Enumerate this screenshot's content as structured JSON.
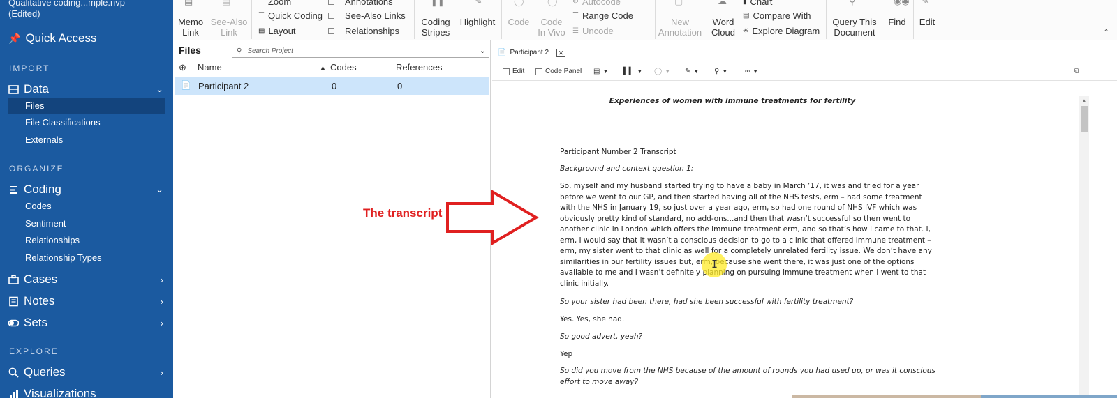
{
  "sidebar": {
    "project_title_line1": "Qualitative coding...mple.nvp",
    "project_title_line2": "(Edited)",
    "quick_access": "Quick Access",
    "sections": {
      "import": "IMPORT",
      "organize": "ORGANIZE",
      "explore": "EXPLORE"
    },
    "data": {
      "label": "Data",
      "items": [
        "Files",
        "File Classifications",
        "Externals"
      ]
    },
    "coding": {
      "label": "Coding",
      "items": [
        "Codes",
        "Sentiment",
        "Relationships",
        "Relationship Types"
      ]
    },
    "cases": "Cases",
    "notes": "Notes",
    "sets": "Sets",
    "queries": "Queries",
    "visualizations": "Visualizations"
  },
  "ribbon": {
    "memo_link": [
      "Memo",
      "Link"
    ],
    "see_also_link": [
      "See-Also",
      "Link"
    ],
    "zoom": "Zoom",
    "quick_coding": "Quick Coding",
    "layout": "Layout",
    "annotations": "Annotations",
    "see_also_links": "See-Also Links",
    "relationships": "Relationships",
    "coding_stripes": [
      "Coding",
      "Stripes"
    ],
    "highlight": "Highlight",
    "code": "Code",
    "code_in_vivo": [
      "Code",
      "In Vivo"
    ],
    "autocode": "Autocode",
    "range_code": "Range Code",
    "uncode": "Uncode",
    "new_annotation": [
      "New",
      "Annotation"
    ],
    "word_cloud": [
      "Word",
      "Cloud"
    ],
    "chart": "Chart",
    "compare_with": "Compare With",
    "explore_diagram": "Explore Diagram",
    "query_this_document": [
      "Query This",
      "Document"
    ],
    "find": "Find",
    "edit": "Edit"
  },
  "files_panel": {
    "title": "Files",
    "search_placeholder": "Search Project",
    "columns": {
      "name": "Name",
      "codes": "Codes",
      "references": "References"
    },
    "rows": [
      {
        "name": "Participant 2",
        "codes": "0",
        "references": "0"
      }
    ]
  },
  "document": {
    "tab_label": "Participant 2",
    "toolbar": {
      "edit": "Edit",
      "code_panel": "Code Panel"
    },
    "title": "Experiences of women with immune treatments for fertility",
    "heading": "Participant Number 2 Transcript",
    "question1": "Background and context question 1:",
    "answer1": [
      "So, myself and my husband started trying to have a baby in March ’17, it was and tried for a year",
      "before we went to our GP, and then started having all of the NHS tests, erm – had some treatment",
      "with the NHS in January 19, so just over a year ago, erm, so had one round of NHS IVF which was",
      "obviously pretty kind of standard, no add-ons...and then that wasn’t successful so then went to",
      "another clinic  in London which offers the immune treatment erm, and so that’s how I came to that. I,",
      "erm, I would say that it wasn’t a conscious decision to go to a clinic that offered immune treatment –",
      "erm, my sister went to that clinic as well for a completely unrelated fertility issue. We don’t have any",
      "similarities in our fertility issues but, erm, because she went there, it was just one of the options",
      "available to me and I wasn’t definitely planning on pursuing immune treatment when I went to that",
      "clinic initially."
    ],
    "q2": "So your sister had been there, had she been successful with fertility treatment?",
    "a2": "Yes. Yes, she had.",
    "q3": "So good advert, yeah?",
    "a3": "Yep",
    "q4": [
      "So did you move from the NHS because of the amount of rounds you had used up, or was it conscious",
      "effort to move away?"
    ]
  },
  "annotation": {
    "label": "The transcript",
    "color": "#e02020"
  }
}
